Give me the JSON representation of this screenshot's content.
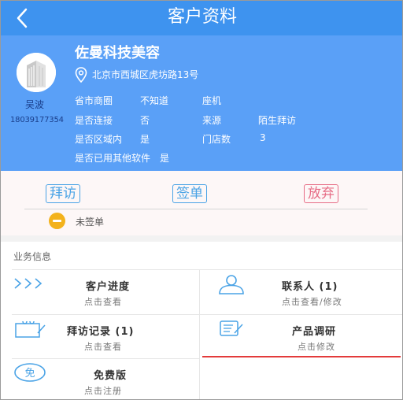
{
  "header": {
    "title": "客户资料"
  },
  "profile": {
    "contact_name": "吴波",
    "contact_phone": "18039177354",
    "company": "佐曼科技美容",
    "address": "北京市西城区虎坊路13号",
    "fields": [
      {
        "label": "省市商圈",
        "value": "不知道"
      },
      {
        "label": "座机",
        "value": ""
      },
      {
        "label": "是否连接",
        "value": "否"
      },
      {
        "label": "来源",
        "value": "陌生拜访"
      },
      {
        "label": "是否区域内",
        "value": "是"
      },
      {
        "label": "门店数",
        "value": "3"
      },
      {
        "label": "是否已用其他软件",
        "value": "是"
      }
    ]
  },
  "actions": {
    "visit": "拜访",
    "sign": "签单",
    "abandon": "放弃",
    "status": "未签单"
  },
  "business": {
    "title": "业务信息",
    "items": [
      {
        "title": "客户进度",
        "sub": "点击查看",
        "icon": "chevrons-icon"
      },
      {
        "title": "联系人 (1)",
        "sub": "点击查看/修改",
        "icon": "person-icon"
      },
      {
        "title": "拜访记录 (1)",
        "sub": "点击查看",
        "icon": "clipboard-icon"
      },
      {
        "title": "产品调研",
        "sub": "点击修改",
        "icon": "checklist-icon"
      },
      {
        "title": "免费版",
        "sub": "点击注册",
        "icon": "free-icon"
      }
    ]
  },
  "colors": {
    "header": "#3e93ef",
    "profile": "#5aa0f7",
    "accent": "#4aa3e6",
    "danger": "#e76d86",
    "status": "#f3b21c"
  }
}
